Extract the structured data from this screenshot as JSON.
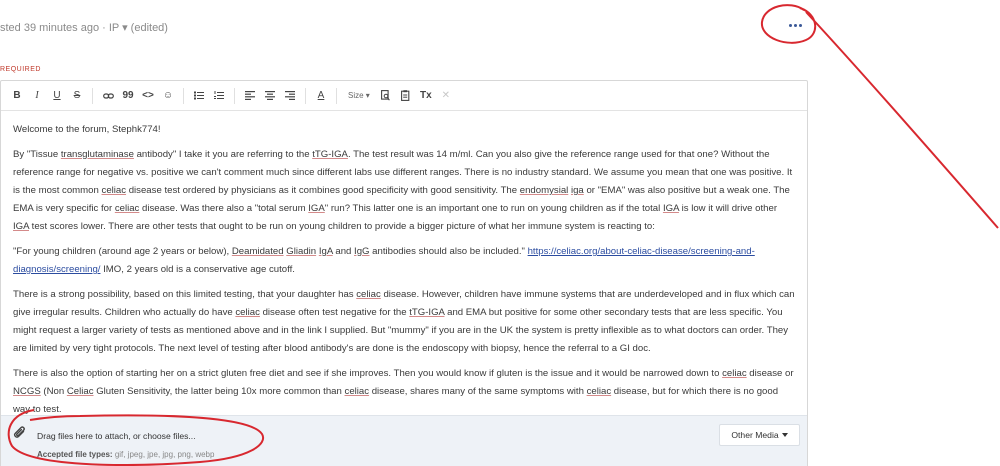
{
  "post_meta": "sted 39 minutes ago · IP ▾ (edited)",
  "form": {
    "required_label": "REQUIRED"
  },
  "toolbar": {
    "size_label": "Size",
    "buttons": {
      "bold": "B",
      "italic": "I",
      "underline": "U",
      "strike": "S",
      "quote": "99",
      "code": "<>",
      "emoji": "☺",
      "font_color": "A",
      "format": "Tx",
      "remove": "✕"
    }
  },
  "content": {
    "p1": "Welcome to the forum, Stephk774!",
    "p2": [
      "By \"Tissue ",
      {
        "w": "transglutaminase",
        "u": 1
      },
      " antibody\" I take it you are referring to the ",
      {
        "w": "tTG-IGA",
        "u": 1
      },
      ". The test result was 14 m/ml. Can you also give the reference range used for that one? Without the reference range for negative vs. positive we can't comment much since different labs use different ranges. There is no industry standard. We assume you mean that one was positive. It is the most common ",
      {
        "w": "celiac",
        "u": 1
      },
      " disease test ordered by physicians as it combines good specificity with good sensitivity. The ",
      {
        "w": "endomysial",
        "u": 1
      },
      " ",
      {
        "w": "iga",
        "u": 1
      },
      " or \"EMA\" was also positive but a weak one. The EMA is very specific for ",
      {
        "w": "celiac",
        "u": 1
      },
      "  disease. Was there also a \"total serum ",
      {
        "w": "IGA",
        "u": 1
      },
      "\" run? This latter one is an important one to run on young children as if the total ",
      {
        "w": "IGA",
        "u": 1
      },
      " is low it will drive other ",
      {
        "w": "IGA",
        "u": 1
      },
      " test scores lower. There are other tests that ought to be run on young children to provide a bigger picture of what her immune system is reacting to:"
    ],
    "p3": [
      "\"For young children (around age 2 years or below), ",
      {
        "w": "Deamidated",
        "u": 1
      },
      " ",
      {
        "w": "Gliadin",
        "u": 1
      },
      " ",
      {
        "w": "IgA",
        "u": 1
      },
      " and ",
      {
        "w": "IgG",
        "u": 1
      },
      " antibodies should also be included.\" ",
      {
        "w": "https://celiac.org/about-celiac-disease/screening-and-diagnosis/screening/",
        "l": 1
      },
      " IMO, 2 years old is a conservative age cutoff."
    ],
    "p4": [
      "There is a strong possibility, based on this limited testing, that your daughter has ",
      {
        "w": "celiac",
        "u": 1
      },
      " disease. However, children have immune systems that are underdeveloped and in flux which can give irregular results. Children who actually do have ",
      {
        "w": "celiac",
        "u": 1
      },
      " disease often test negative for the ",
      {
        "w": "tTG-IGA",
        "u": 1
      },
      " and EMA but positive for some other secondary tests that are less specific. You might request a larger variety of tests as mentioned above and in the link I supplied. But \"mummy\" if you are in the UK the system is pretty inflexible as to what doctors can order. They are limited by very tight protocols. The next level of testing after blood antibody's are done is the endoscopy with biopsy, hence the referral to a GI doc."
    ],
    "p5": [
      "There is also the option of starting her on a strict gluten free diet and see if she improves. Then you would know if gluten is the issue and it would be narrowed down to ",
      {
        "w": "celiac",
        "u": 1
      },
      " disease or ",
      {
        "w": "NCGS",
        "u": 1
      },
      " (Non ",
      {
        "w": "Celiac",
        "u": 1
      },
      " Gluten Sensitivity, the latter being 10x more common than ",
      {
        "w": "celiac",
        "u": 1
      },
      " disease, shares many of the same symptoms with ",
      {
        "w": "celiac",
        "u": 1
      },
      " disease, but for which there is no good way to test."
    ]
  },
  "attachments": {
    "drag_text": "Drag files here to attach, or choose files...",
    "accepted_label": "Accepted file types:",
    "accepted_types": "gif, jpeg, jpe, jpg, png, webp",
    "other_media_label": "Other Media"
  },
  "colors": {
    "annotation": "#d8282f",
    "link": "#2b4ca0",
    "required": "#c0392b"
  }
}
